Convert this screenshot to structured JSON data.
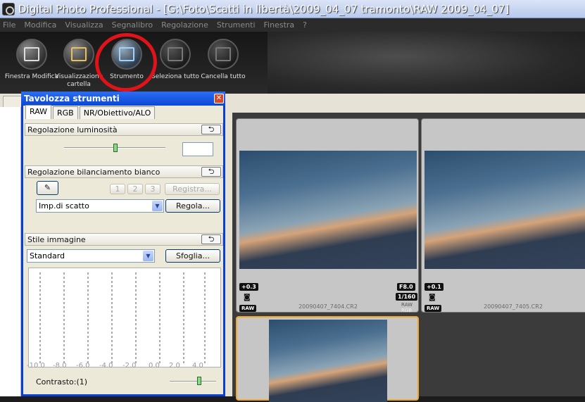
{
  "window": {
    "title": "Digital Photo Professional - [G:\\Foto\\Scatti in libertà\\2009_04_07 tramonto\\RAW 2009_04_07]"
  },
  "menu": [
    "File",
    "Modifica",
    "Visualizza",
    "Segnalibro",
    "Regolazione",
    "Strumenti",
    "Finestra",
    "?"
  ],
  "toolbar": [
    {
      "label": "Finestra Modifica",
      "icon": "edit-window-icon"
    },
    {
      "label": "Visualizzazione cartella",
      "icon": "folder-view-icon"
    },
    {
      "label": "Strumento",
      "icon": "tool-palette-icon"
    },
    {
      "label": "Seleziona tutto",
      "icon": "select-all-icon"
    },
    {
      "label": "Cancella tutto",
      "icon": "clear-all-icon"
    }
  ],
  "annotation_color": "#e0121a",
  "panel": {
    "title": "Tavolozza strumenti",
    "tabs": [
      "RAW",
      "RGB",
      "NR/Obiettivo/ALO"
    ],
    "brightness_label": "Regolazione luminosità",
    "white_balance_label": "Regolazione bilanciamento bianco",
    "wb_slots": [
      "1",
      "2",
      "3"
    ],
    "register_label": "Registra...",
    "wb_select": "Imp.di scatto",
    "adjust_label": "Regola...",
    "style_label": "Stile immagine",
    "style_select": "Standard",
    "browse_label": "Sfoglia...",
    "axis_ticks": [
      "-10.0",
      "-8.0",
      "-6.0",
      "-4.0",
      "-2.0",
      "0.0",
      "2.0",
      "4.0"
    ],
    "contrast_label": "Contrasto:(1)"
  },
  "thumbnails": [
    {
      "filename": "20090407_7404.CR2",
      "exposure": "+0.3",
      "aperture": "F8.0",
      "shutter": "1/160",
      "format": "RAW",
      "rgb": "RGB"
    },
    {
      "filename": "20090407_7405.CR2",
      "exposure": "+0.1",
      "format": "RAW"
    }
  ]
}
